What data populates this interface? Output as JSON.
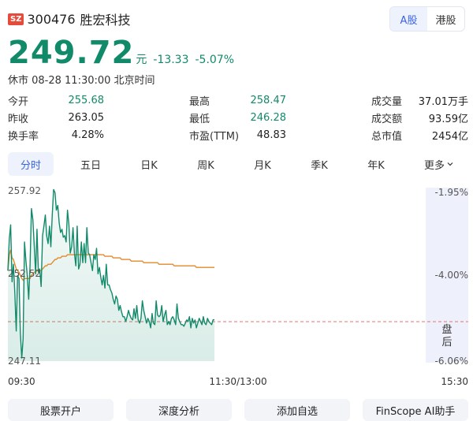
{
  "header": {
    "exchange": "SZ",
    "code": "300476",
    "name": "胜宏科技"
  },
  "market_toggle": [
    {
      "label": "A股",
      "active": true
    },
    {
      "label": "港股",
      "active": false
    }
  ],
  "quote": {
    "price": "249.72",
    "unit": "元",
    "change": "-13.33",
    "change_pct": "-5.07%"
  },
  "status": "休市 08-28 11:30:00 北京时间",
  "stats": [
    {
      "label": "今开",
      "value": "255.68",
      "color": "green"
    },
    {
      "label": "最高",
      "value": "258.47",
      "color": "green"
    },
    {
      "label": "成交量",
      "value": "37.01万手",
      "color": "dark"
    },
    {
      "label": "昨收",
      "value": "263.05",
      "color": "dark"
    },
    {
      "label": "最低",
      "value": "246.28",
      "color": "green"
    },
    {
      "label": "成交额",
      "value": "93.59亿",
      "color": "dark"
    },
    {
      "label": "换手率",
      "value": "4.28%",
      "color": "dark"
    },
    {
      "label": "市盈(TTM)",
      "value": "48.83",
      "color": "dark"
    },
    {
      "label": "总市值",
      "value": "2454亿",
      "color": "dark"
    }
  ],
  "tabs": [
    {
      "label": "分时",
      "active": true
    },
    {
      "label": "五日"
    },
    {
      "label": "日K"
    },
    {
      "label": "周K"
    },
    {
      "label": "月K"
    },
    {
      "label": "季K"
    },
    {
      "label": "年K"
    },
    {
      "label": "更多"
    }
  ],
  "colors": {
    "down": "#118a6a",
    "avg": "#e08a2c",
    "prev_close": "#e57373",
    "closed_bg": "#eef0fb",
    "accent": "#3b63e0"
  },
  "chart_data": {
    "type": "line",
    "y_labels_left": [
      "257.92",
      "252.52",
      "247.11"
    ],
    "y_labels_right": [
      "-1.95%",
      "-4.00%",
      "-6.06%"
    ],
    "x_labels": [
      "09:30",
      "11:30/13:00",
      "15:30"
    ],
    "ylim": [
      247.11,
      257.92
    ],
    "prev_close": 263.05,
    "closed_label": "盘后",
    "series": [
      {
        "values": [
          252.8,
          254.8,
          255.68,
          252.1,
          253.2,
          251.4,
          249.0,
          252.5,
          252.3,
          248.9,
          247.3,
          248.5,
          254.6,
          253.4,
          252.5,
          251.0,
          253.1,
          256.7,
          256.0,
          254.4,
          252.6,
          255.4,
          252.7,
          252.9,
          251.8,
          255.0,
          255.6,
          256.3,
          255.0,
          254.5,
          255.6,
          254.3,
          256.3,
          257.9,
          257.7,
          256.6,
          256.9,
          255.8,
          255.2,
          255.4,
          254.9,
          255.0,
          254.6,
          256.6,
          255.7,
          253.9,
          254.3,
          255.5,
          253.9,
          253.1,
          255.6,
          252.9,
          253.2,
          254.6,
          253.3,
          254.5,
          253.3,
          255.5,
          253.9,
          253.8,
          253.3,
          252.8,
          253.8,
          253.5,
          254.2,
          252.6,
          253.0,
          252.4,
          251.9,
          252.5,
          251.7,
          253.2,
          251.9,
          251.9,
          251.6,
          251.4,
          251.0,
          250.7,
          251.2,
          251.0,
          250.3,
          250.6,
          250.2,
          249.9,
          249.9,
          249.6,
          249.9,
          250.3,
          250.0,
          249.8,
          249.7,
          250.4,
          249.8,
          250.6,
          249.7,
          249.5,
          249.8,
          250.9,
          250.3,
          249.9,
          249.5,
          249.8,
          249.6,
          249.2,
          250.1,
          249.5,
          249.4,
          250.9,
          250.0,
          249.9,
          250.0,
          250.6,
          249.6,
          250.0,
          250.3,
          249.4,
          249.6,
          249.4,
          249.8,
          249.9,
          249.7,
          249.4,
          250.7,
          249.8,
          249.6,
          249.4,
          249.4,
          249.3,
          249.5,
          249.7,
          249.6,
          249.9,
          249.2,
          249.8,
          249.5,
          249.7,
          249.2,
          249.5,
          249.8,
          249.6,
          249.4,
          249.9,
          249.5,
          249.4,
          249.8,
          249.6,
          249.5,
          249.4,
          249.7,
          249.72
        ]
      },
      {
        "name_hidden": true,
        "values": [
          252.8,
          253.8,
          254.1,
          253.6,
          253.5,
          253.2,
          252.9,
          252.8,
          252.7,
          252.5,
          252.3,
          252.2,
          252.3,
          252.3,
          252.3,
          252.3,
          252.3,
          252.5,
          252.6,
          252.7,
          252.7,
          252.8,
          252.8,
          252.8,
          252.8,
          252.9,
          253.0,
          253.1,
          253.1,
          253.2,
          253.2,
          253.2,
          253.3,
          253.4,
          253.5,
          253.5,
          253.6,
          253.6,
          253.6,
          253.7,
          253.7,
          253.7,
          253.7,
          253.8,
          253.8,
          253.8,
          253.8,
          253.8,
          253.8,
          253.8,
          253.8,
          253.8,
          253.8,
          253.8,
          253.8,
          253.8,
          253.8,
          253.8,
          253.8,
          253.8,
          253.8,
          253.8,
          253.8,
          253.8,
          253.8,
          253.8,
          253.8,
          253.8,
          253.8,
          253.8,
          253.7,
          253.7,
          253.7,
          253.7,
          253.7,
          253.7,
          253.6,
          253.6,
          253.6,
          253.6,
          253.6,
          253.6,
          253.5,
          253.5,
          253.5,
          253.5,
          253.5,
          253.5,
          253.5,
          253.4,
          253.4,
          253.4,
          253.4,
          253.4,
          253.4,
          253.4,
          253.4,
          253.4,
          253.3,
          253.3,
          253.3,
          253.3,
          253.3,
          253.3,
          253.3,
          253.3,
          253.3,
          253.3,
          253.3,
          253.2,
          253.2,
          253.2,
          253.2,
          253.2,
          253.2,
          253.2,
          253.2,
          253.2,
          253.2,
          253.2,
          253.1,
          253.1,
          253.1,
          253.1,
          253.1,
          253.1,
          253.1,
          253.1,
          253.1,
          253.1,
          253.1,
          253.1,
          253.1,
          253.1,
          253.1,
          253.1,
          253.0,
          253.0,
          253.0,
          253.0,
          253.0,
          253.0,
          253.0,
          253.0,
          253.0,
          253.0,
          253.0,
          253.0,
          253.0,
          253.0
        ]
      }
    ]
  },
  "bottom_buttons": [
    "股票开户",
    "深度分析",
    "添加自选",
    "FinScope AI助手"
  ]
}
